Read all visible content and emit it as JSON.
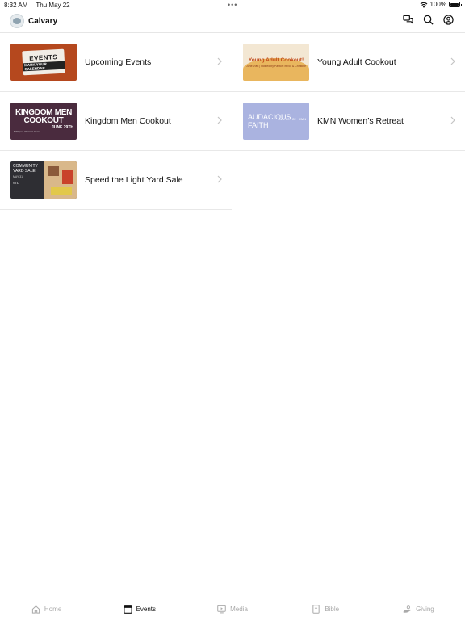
{
  "status": {
    "time": "8:32 AM",
    "date": "Thu May 22",
    "battery": "100%",
    "battery_level": 1.0
  },
  "nav": {
    "title": "Calvary"
  },
  "events": [
    {
      "label": "Upcoming Events",
      "thumb": {
        "line1": "EVENTS",
        "line2": "MARK YOUR CALENDAR"
      }
    },
    {
      "label": "Young Adult Cookout",
      "thumb": {
        "line1": "Young Adult Cookout!",
        "line2": "June 29th | Hosted by Pastor Trevor & Christine"
      }
    },
    {
      "label": "Kingdom Men Cookout",
      "thumb": {
        "line1": "KINGDOM MEN COOKOUT",
        "line2": "JUNE 29TH",
        "line3": "6:00 pm · Pastor's Home"
      }
    },
    {
      "label": "KMN Women’s Retreat",
      "thumb": {
        "line1": "AUDACIOUS FAITH",
        "line2": "June 20 - 22 · KMN"
      }
    },
    {
      "label": "Speed the Light Yard Sale",
      "thumb": {
        "line1": "COMMUNITY YARD SALE",
        "line2": "MAY 31",
        "line3": "STL"
      }
    }
  ],
  "tabs": [
    {
      "label": "Home",
      "icon": "home-icon"
    },
    {
      "label": "Events",
      "icon": "calendar-icon"
    },
    {
      "label": "Media",
      "icon": "media-icon"
    },
    {
      "label": "Bible",
      "icon": "bible-icon"
    },
    {
      "label": "Giving",
      "icon": "giving-icon"
    }
  ],
  "colors": {
    "active_tab": "#111111",
    "inactive_tab": "#aaaaaa",
    "divider": "#e8e8e8"
  }
}
